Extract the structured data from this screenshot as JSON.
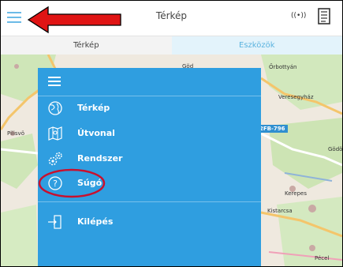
{
  "header": {
    "title": "Térkép",
    "signal_text": "((•))",
    "menu_icon": "hamburger-menu-icon",
    "signal_icon": "radio-signal-icon",
    "document_icon": "document-icon"
  },
  "tabs": [
    {
      "label": "Térkép",
      "active": true
    },
    {
      "label": "Eszközök",
      "active": false
    }
  ],
  "drawer": {
    "items": [
      {
        "label": "Térkép",
        "icon": "globe-icon"
      },
      {
        "label": "Útvonal",
        "icon": "route-map-icon"
      },
      {
        "label": "Rendszer",
        "icon": "gears-icon"
      },
      {
        "label": "Súgó",
        "icon": "help-icon"
      },
      {
        "label": "Kilépés",
        "icon": "logout-icon"
      }
    ]
  },
  "map": {
    "place_labels": [
      "Göd",
      "Őrbottyán",
      "Veresegyház",
      "Pilisvö",
      "Gödöll",
      "Kerepes",
      "Kistarcsa",
      "Pécel"
    ],
    "road_label": "2FB-796"
  },
  "annotations": {
    "arrow_color": "#e01414",
    "circle_color": "#c8102e"
  }
}
